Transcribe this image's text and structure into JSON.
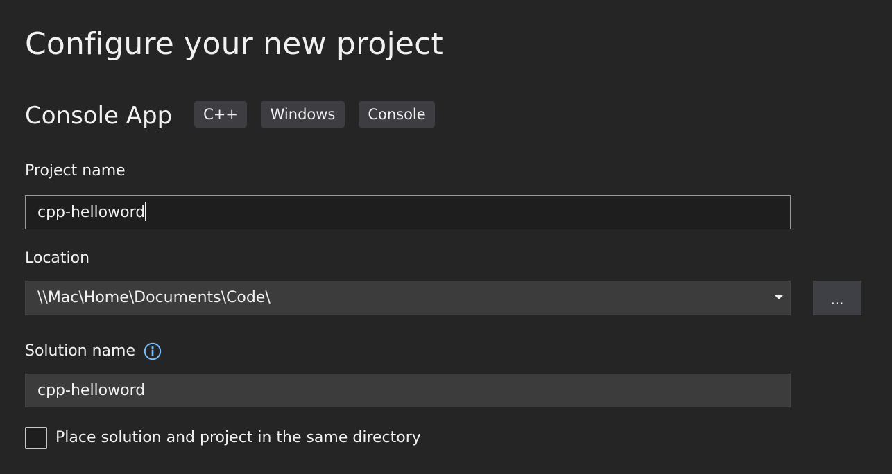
{
  "header": {
    "title": "Configure your new project"
  },
  "template": {
    "name": "Console App",
    "tags": [
      "C++",
      "Windows",
      "Console"
    ]
  },
  "project_name": {
    "label": "Project name",
    "value": "cpp-helloword"
  },
  "location": {
    "label": "Location",
    "value": "\\\\Mac\\Home\\Documents\\Code\\",
    "browse_label": "..."
  },
  "solution_name": {
    "label": "Solution name",
    "value": "cpp-helloword",
    "info_icon": "info-icon"
  },
  "same_directory": {
    "label": "Place solution and project in the same directory",
    "checked": false
  },
  "colors": {
    "background": "#252526",
    "tag_background": "#3e3e42",
    "input_background": "#3c3c3c",
    "info_accent": "#75beff"
  }
}
